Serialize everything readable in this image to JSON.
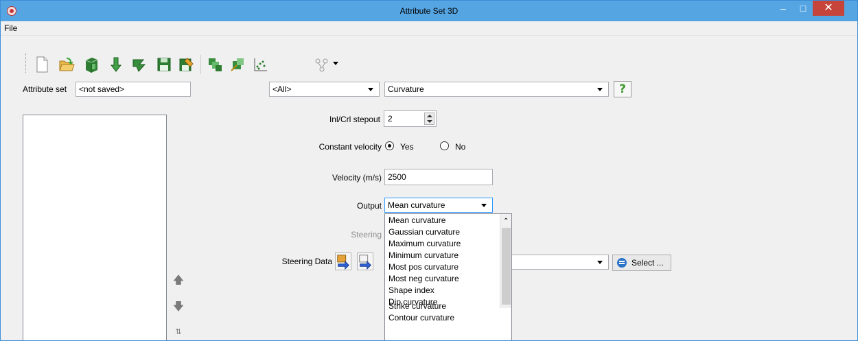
{
  "window": {
    "title": "Attribute Set 3D"
  },
  "menu": {
    "items": [
      "File"
    ]
  },
  "toolbar": {
    "icons": [
      "new-document-icon",
      "open-folder-icon",
      "green-cube-icon",
      "green-arrow-down-icon",
      "green-arrow-right-icon",
      "save-icon",
      "save-as-icon",
      "multi-attribute-icon",
      "evaluate-attribute-icon",
      "crossplot-icon",
      "network-icon"
    ]
  },
  "attribute_set": {
    "label": "Attribute set",
    "value": "<not saved>"
  },
  "category_select": {
    "value": "<All>"
  },
  "attribute_select": {
    "value": "Curvature"
  },
  "help": {
    "label": "?"
  },
  "stepout": {
    "label": "Inl/Crl stepout",
    "value": "2"
  },
  "constant_velocity": {
    "label": "Constant velocity",
    "yes": "Yes",
    "no": "No",
    "selected": "Yes"
  },
  "velocity": {
    "label": "Velocity (m/s)",
    "value": "2500"
  },
  "output": {
    "label": "Output",
    "value": "Mean curvature",
    "options": [
      "Mean curvature",
      "Gaussian curvature",
      "Maximum curvature",
      "Minimum curvature",
      "Most pos curvature",
      "Most neg curvature",
      "Shape index",
      "Dip curvature",
      "Strike curvature",
      "Contour curvature"
    ]
  },
  "steering": {
    "label": "Steering"
  },
  "steering_data": {
    "label": "Steering Data",
    "select_label": "Select ..."
  }
}
